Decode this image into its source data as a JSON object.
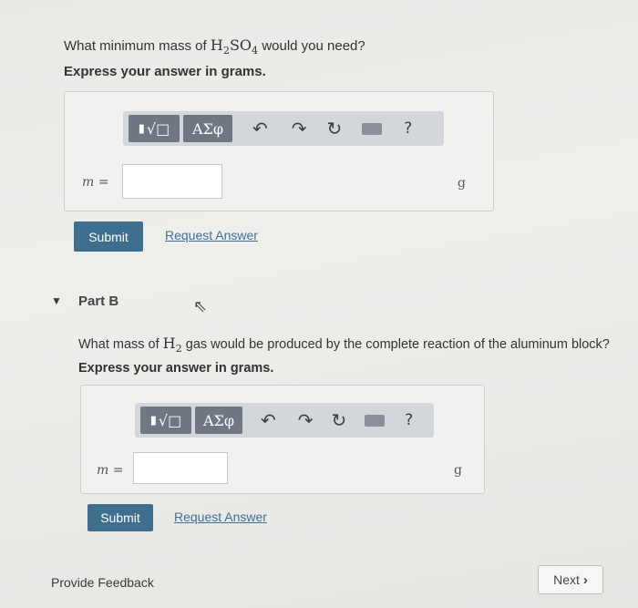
{
  "partA": {
    "question_pre": "What minimum mass of ",
    "formula_main": "H",
    "formula_sub1": "2",
    "formula_mid": "SO",
    "formula_sub2": "4",
    "question_post": " would you need?",
    "instruction": "Express your answer in grams.",
    "variable": "m =",
    "unit": "g",
    "submit_label": "Submit",
    "request_label": "Request Answer"
  },
  "toolbar": {
    "template_label": "√□",
    "greek_label": "ΑΣφ",
    "help_label": "?"
  },
  "partB": {
    "title": "Part B",
    "question_pre": "What mass of ",
    "formula_main": "H",
    "formula_sub": "2",
    "question_post": " gas would be produced by the complete reaction of the aluminum block?",
    "instruction": "Express your answer in grams.",
    "variable": "m =",
    "unit": "g",
    "submit_label": "Submit",
    "request_label": "Request Answer"
  },
  "footer": {
    "feedback_label": "Provide Feedback",
    "next_label": "Next"
  },
  "colors": {
    "submit": "#3f6f8e",
    "link": "#3f6f9a",
    "toolbar": "#d3d7dc"
  }
}
